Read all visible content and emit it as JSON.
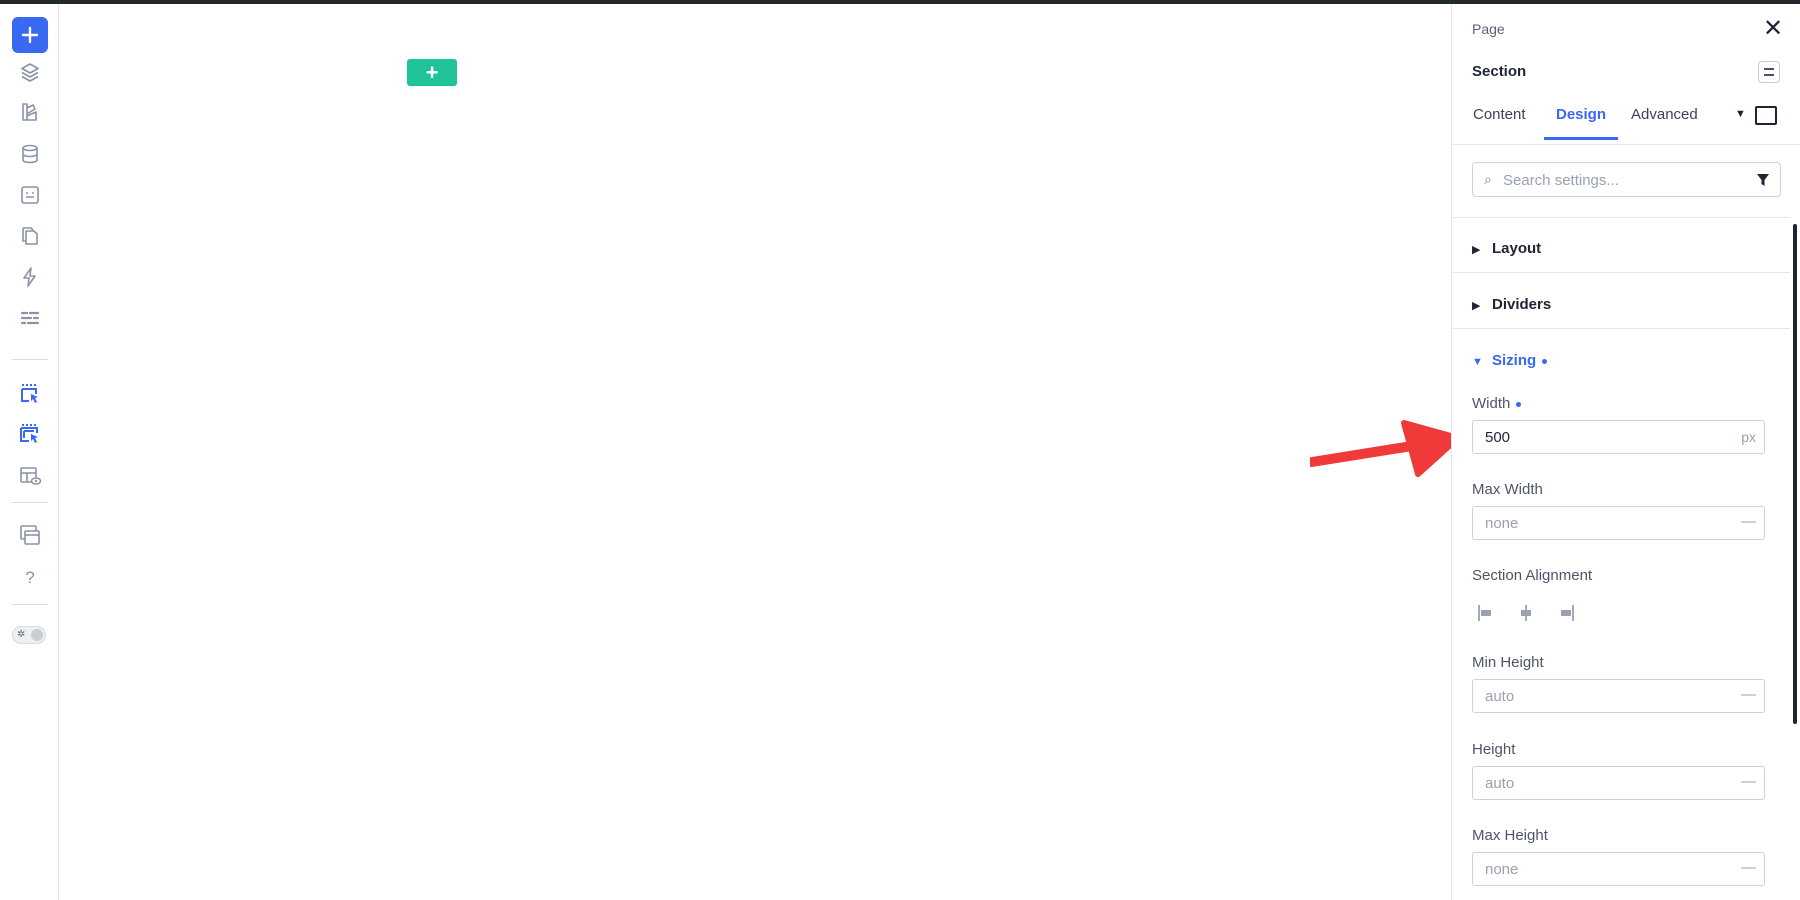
{
  "canvas": {
    "add_label": "+"
  },
  "left_rail": {
    "add_label": "+",
    "help_label": "?",
    "icons": [
      "layers-icon",
      "components-icon",
      "database-icon",
      "template-icon",
      "pages-icon",
      "interactions-icon",
      "settings-icon",
      "select-element-icon",
      "select-parent-icon",
      "preview-icon",
      "windows-icon",
      "help-icon",
      "theme-toggle-icon"
    ]
  },
  "panel": {
    "breadcrumb": "Page",
    "section_title": "Section",
    "close_label": "✕",
    "tabs": [
      {
        "label": "Content"
      },
      {
        "label": "Design"
      },
      {
        "label": "Advanced"
      }
    ],
    "search": {
      "placeholder": "Search settings...",
      "value": ""
    },
    "accordions": {
      "layout": "Layout",
      "dividers": "Dividers",
      "sizing": "Sizing"
    },
    "fields": {
      "width": {
        "label": "Width",
        "value": "500",
        "unit": "px"
      },
      "max_width": {
        "label": "Max Width",
        "placeholder": "none",
        "dash": "—"
      },
      "section_alignment": {
        "label": "Section Alignment"
      },
      "min_height": {
        "label": "Min Height",
        "placeholder": "auto",
        "dash": "—"
      },
      "height": {
        "label": "Height",
        "placeholder": "auto",
        "dash": "—"
      },
      "max_height": {
        "label": "Max Height",
        "placeholder": "none",
        "dash": "—"
      }
    }
  },
  "colors": {
    "accent": "#3968f2",
    "canvas_add": "#1ec39a",
    "annotation_arrow": "#f03a3a"
  }
}
